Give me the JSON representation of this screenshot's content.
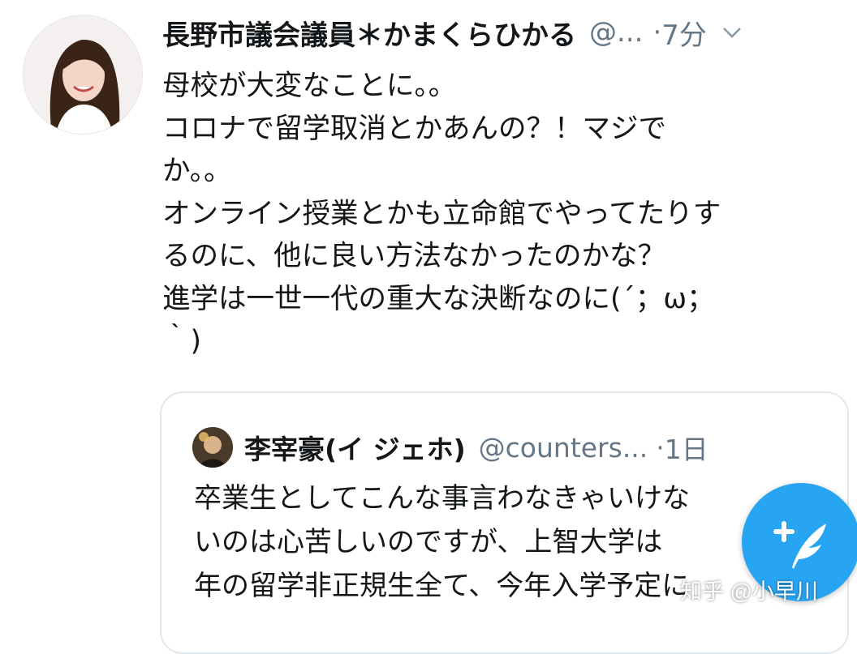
{
  "tweet": {
    "display_name": "長野市議会議員＊かまくらひかる",
    "handle": "@...",
    "separator": "·",
    "timestamp": "7分",
    "text_lines": [
      "母校が大変なことに。。",
      "コロナで留学取消とかあんの？！マジで",
      "か。。",
      "オンライン授業とかも立命館でやってたりす",
      "るのに、他に良い方法なかったのかな？",
      "進学は一世一代の重大な決断なのに(´；ω；",
      "｀)"
    ],
    "icons": {
      "avatar": "profile-photo",
      "menu": "chevron-down-icon"
    }
  },
  "quoted_tweet": {
    "display_name": "李宰豪(イ ジェホ)",
    "handle": "@counters...",
    "separator": "·",
    "timestamp": "1日",
    "text_lines": [
      "卒業生としてこんな事言わなきゃいけな",
      "いのは心苦しいのですが、上智大学は",
      "年の留学非正規生全て、今年入学予定に"
    ]
  },
  "compose_button": {
    "icon": "compose-feather-icon",
    "color": "#1da1f2"
  },
  "watermark": "知乎 @小早川",
  "colors": {
    "text": "#14171a",
    "secondary": "#657786",
    "border": "#e1e8ed",
    "accent": "#1da1f2"
  }
}
